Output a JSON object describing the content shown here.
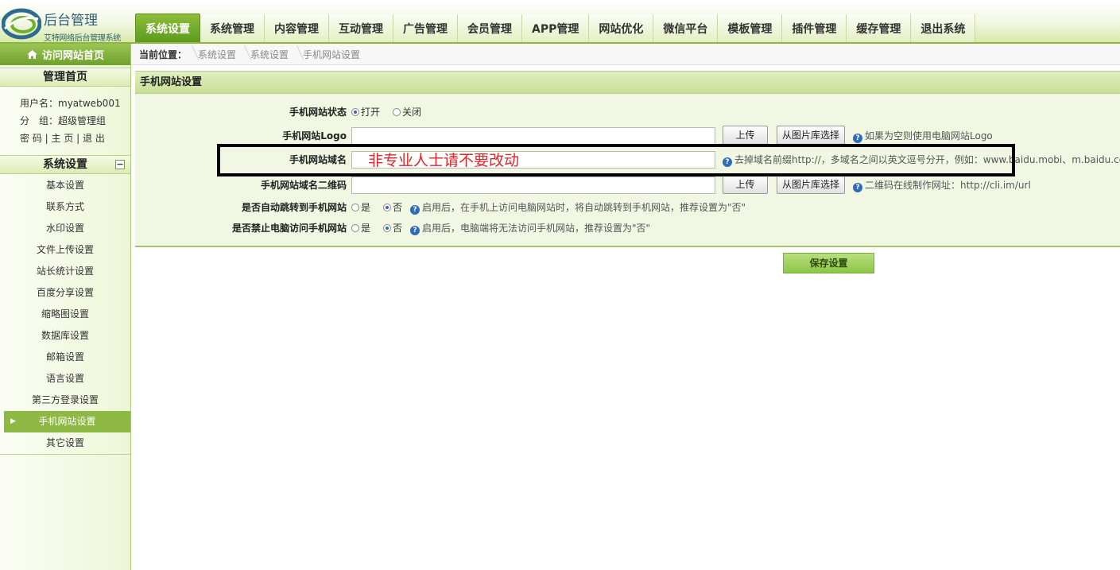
{
  "logo": {
    "title": "后台管理",
    "subtitle": "艾特网络后台管理系统"
  },
  "nav": {
    "tabs": [
      {
        "label": "系统设置",
        "active": true
      },
      {
        "label": "系统管理"
      },
      {
        "label": "内容管理"
      },
      {
        "label": "互动管理"
      },
      {
        "label": "广告管理"
      },
      {
        "label": "会员管理"
      },
      {
        "label": "APP管理"
      },
      {
        "label": "网站优化"
      },
      {
        "label": "微信平台"
      },
      {
        "label": "模板管理"
      },
      {
        "label": "插件管理"
      },
      {
        "label": "缓存管理"
      },
      {
        "label": "退出系统"
      }
    ]
  },
  "sidebar": {
    "visit_label": "访问网站首页",
    "home_head": "管理首页",
    "user": {
      "username_label": "用户名：",
      "username": "myatweb001",
      "group_label": "分　组：",
      "group": "超级管理组",
      "links": [
        "密 码",
        "主 页",
        "退 出"
      ]
    },
    "section_title": "系统设置",
    "collapse_symbol": "−",
    "items": [
      {
        "label": "基本设置"
      },
      {
        "label": "联系方式"
      },
      {
        "label": "水印设置"
      },
      {
        "label": "文件上传设置"
      },
      {
        "label": "站长统计设置"
      },
      {
        "label": "百度分享设置"
      },
      {
        "label": "缩略图设置"
      },
      {
        "label": "数据库设置"
      },
      {
        "label": "邮箱设置"
      },
      {
        "label": "语言设置"
      },
      {
        "label": "第三方登录设置"
      },
      {
        "label": "手机网站设置",
        "active": true
      },
      {
        "label": "其它设置"
      }
    ]
  },
  "breadcrumb": {
    "label": "当前位置：",
    "items": [
      "系统设置",
      "系统设置",
      "手机网站设置"
    ]
  },
  "panel": {
    "title": "手机网站设置",
    "status": {
      "label": "手机网站状态",
      "on": "打开",
      "off": "关闭",
      "selected": "on"
    },
    "logo": {
      "label": "手机网站Logo",
      "value": "",
      "upload": "上传",
      "choose": "从图片库选择",
      "help": "如果为空则使用电脑网站Logo"
    },
    "domain": {
      "label": "手机网站域名",
      "value": "",
      "help": "去掉域名前缀http://，多域名之间以英文逗号分开，例如：www.baidu.mobi、m.baidu.com"
    },
    "qrcode": {
      "label": "手机网站域名二维码",
      "value": "",
      "upload": "上传",
      "choose": "从图片库选择",
      "help": "二维码在线制作网址：http://cli.im/url"
    },
    "redirect": {
      "label": "是否自动跳转到手机网站",
      "yes": "是",
      "no": "否",
      "selected": "no",
      "help": "启用后，在手机上访问电脑网站时，将自动跳转到手机网站，推荐设置为\"否\""
    },
    "forbid": {
      "label": "是否禁止电脑访问手机网站",
      "yes": "是",
      "no": "否",
      "selected": "no",
      "help": "启用后，电脑端将无法访问手机网站，推荐设置为\"否\""
    }
  },
  "annotation": "非专业人士请不要改动",
  "save_label": "保存设置",
  "colors": {
    "accent": "#8db843",
    "annotation_red": "#e0262a",
    "help_icon": "#2f6bb8"
  }
}
